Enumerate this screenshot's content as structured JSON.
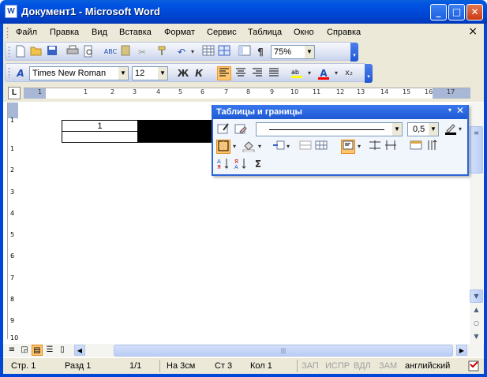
{
  "window": {
    "title": "Документ1 - Microsoft Word",
    "app_icon_letter": "W"
  },
  "window_controls": {
    "minimize": "_",
    "maximize": "□",
    "close": "✕"
  },
  "menu": {
    "items": [
      "Файл",
      "Правка",
      "Вид",
      "Вставка",
      "Формат",
      "Сервис",
      "Таблица",
      "Окно",
      "Справка"
    ],
    "close_glyph": "×"
  },
  "standard_toolbar": {
    "icons": [
      "new-icon",
      "open-icon",
      "save-icon",
      "print-icon",
      "print-preview-icon",
      "spelling-icon",
      "research-icon",
      "cut-icon",
      "format-painter-icon",
      "undo-icon",
      "insert-table-icon",
      "tables-borders-icon",
      "document-map-icon",
      "show-formatting-icon"
    ],
    "zoom": "75%",
    "show_formatting_glyph": "¶"
  },
  "formatting_toolbar": {
    "styles_glyph": "A",
    "font": "Times New Roman",
    "size": "12",
    "bold": "Ж",
    "italic": "К",
    "align_left_selected": true,
    "font_color_letter": "A",
    "subscript_label": "x₂"
  },
  "ruler": {
    "corner": "L",
    "h_labels": [
      "1",
      "1",
      "2",
      "3",
      "4",
      "5",
      "6",
      "7",
      "8",
      "9",
      "10",
      "11",
      "12",
      "13",
      "14",
      "15",
      "16",
      "17"
    ],
    "v_labels": [
      "1",
      "1",
      "2",
      "3",
      "4",
      "5",
      "6",
      "7",
      "8",
      "9",
      "10"
    ]
  },
  "document": {
    "table_cell_text": "1"
  },
  "floating_toolbar": {
    "title": "Таблицы и границы",
    "close": "✕",
    "dropdown": "▾",
    "line_weight": "0,5",
    "sigma": "Σ"
  },
  "status": {
    "page": "Стр. 1",
    "section": "Разд 1",
    "page_of": "1/1",
    "at": "На 3см",
    "line": "Ст 3",
    "col": "Кол 1",
    "rec": "ЗАП",
    "trk": "ИСПР",
    "ext": "ВДЛ",
    "ovr": "ЗАМ",
    "language": "английский"
  },
  "colors": {
    "title_blue": "#0047d6",
    "toolbar_bg": "#ece9d8",
    "selection_orange": "#ffc670",
    "font_color_red": "#ff0000",
    "highlight_yellow": "#ffff00"
  }
}
